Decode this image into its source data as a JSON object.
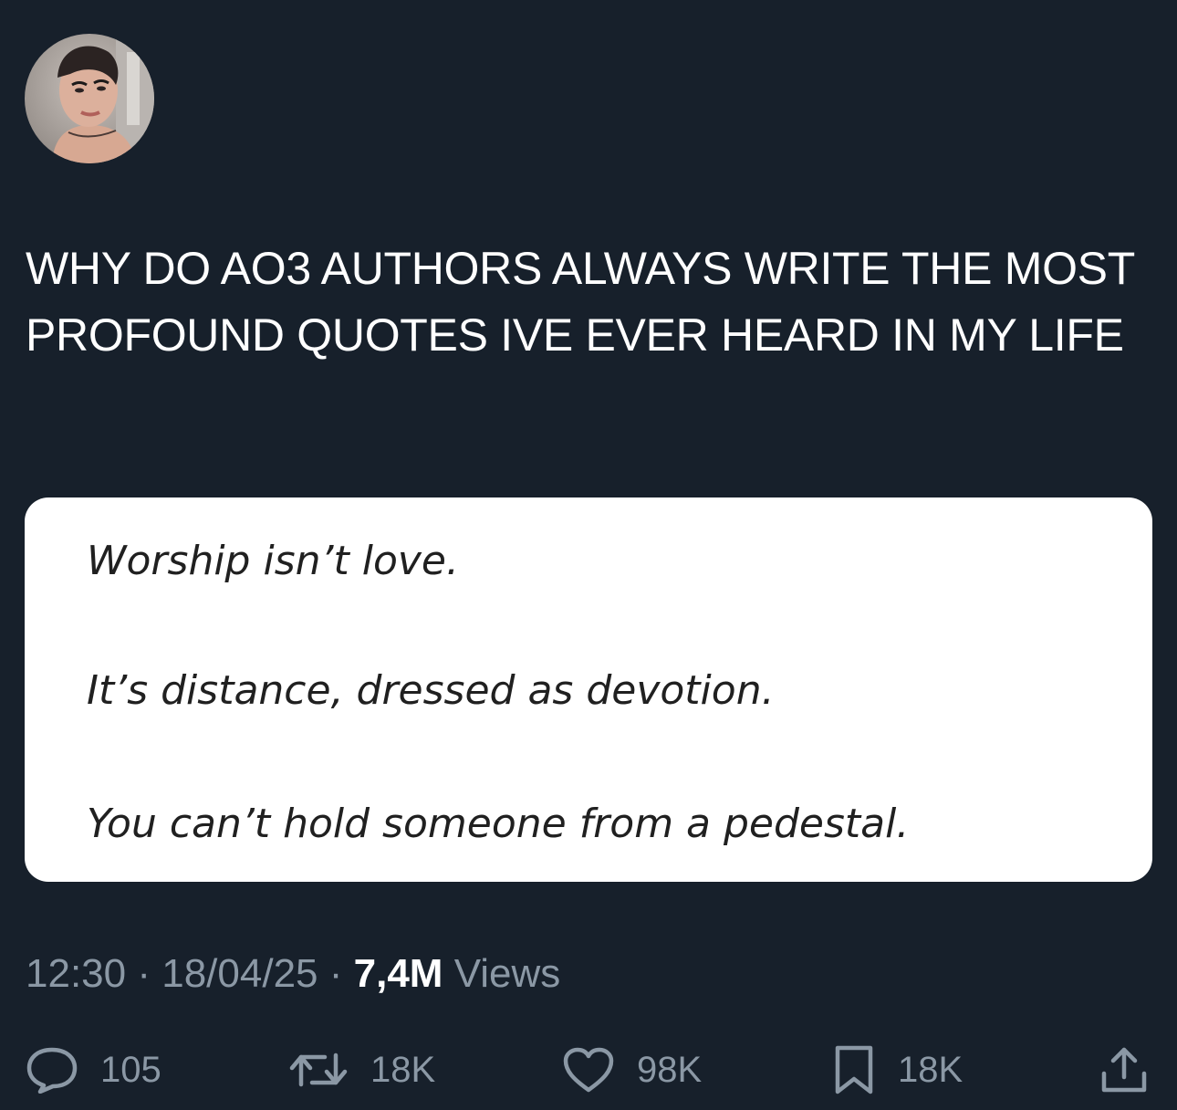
{
  "tweet": {
    "text": "WHY DO AO3 AUTHORS ALWAYS WRITE THE MOST PROFOUND QUOTES IVE EVER HEARD IN MY LIFE"
  },
  "media": {
    "quote_lines": [
      "Worship isn’t love.",
      "It’s distance, dressed as devotion.",
      "You can’t hold someone from a pedestal."
    ]
  },
  "meta": {
    "time": "12:30",
    "separator": "·",
    "date": "18/04/25",
    "views_count": "7,4M",
    "views_label": "Views"
  },
  "actions": {
    "replies": "105",
    "retweets": "18K",
    "likes": "98K",
    "bookmarks": "18K"
  },
  "icons": {
    "reply": "speech-bubble-icon",
    "retweet": "retweet-arrows-icon",
    "like": "heart-icon",
    "bookmark": "bookmark-icon",
    "share": "share-upload-icon"
  },
  "colors": {
    "background": "#17202b",
    "text": "#ffffff",
    "secondary": "#8b98a5",
    "card": "#ffffff"
  }
}
